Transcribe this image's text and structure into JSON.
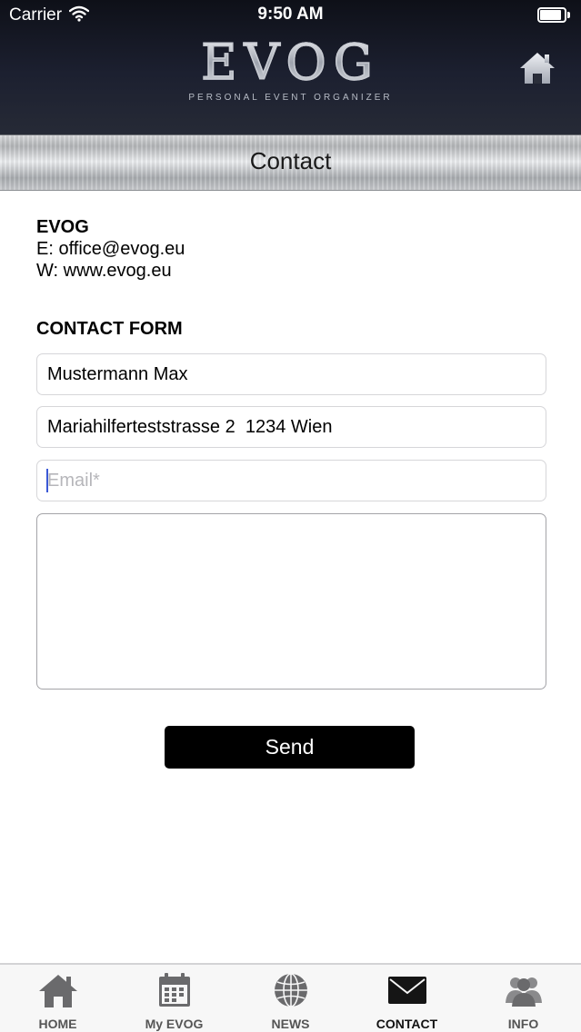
{
  "status_bar": {
    "carrier": "Carrier",
    "time": "9:50 AM",
    "battery_level": 0.9
  },
  "header": {
    "logo_text": "EVOG",
    "logo_tagline": "PERSONAL   EVENT   ORGANIZER",
    "home_icon": "home-icon"
  },
  "page": {
    "title": "Contact"
  },
  "company": {
    "name": "EVOG",
    "email_line": "E: office@evog.eu",
    "web_line": "W: www.evog.eu"
  },
  "form": {
    "heading": "CONTACT FORM",
    "name_value": "Mustermann Max",
    "address_value": "Mariahilferteststrasse 2  1234 Wien",
    "email_value": "",
    "email_placeholder": "Email*",
    "message_value": "",
    "send_label": "Send"
  },
  "tabbar": {
    "items": [
      {
        "label": "HOME",
        "icon": "home-icon"
      },
      {
        "label": "My EVOG",
        "icon": "calendar-icon"
      },
      {
        "label": "NEWS",
        "icon": "globe-icon"
      },
      {
        "label": "CONTACT",
        "icon": "envelope-icon",
        "active": true
      },
      {
        "label": "INFO",
        "icon": "people-icon"
      }
    ]
  },
  "colors": {
    "header_dark": "#1c2030",
    "button_bg": "#000000",
    "cursor_blue": "#3a58d6",
    "tab_active": "#111111",
    "tab_inactive": "#555555"
  }
}
